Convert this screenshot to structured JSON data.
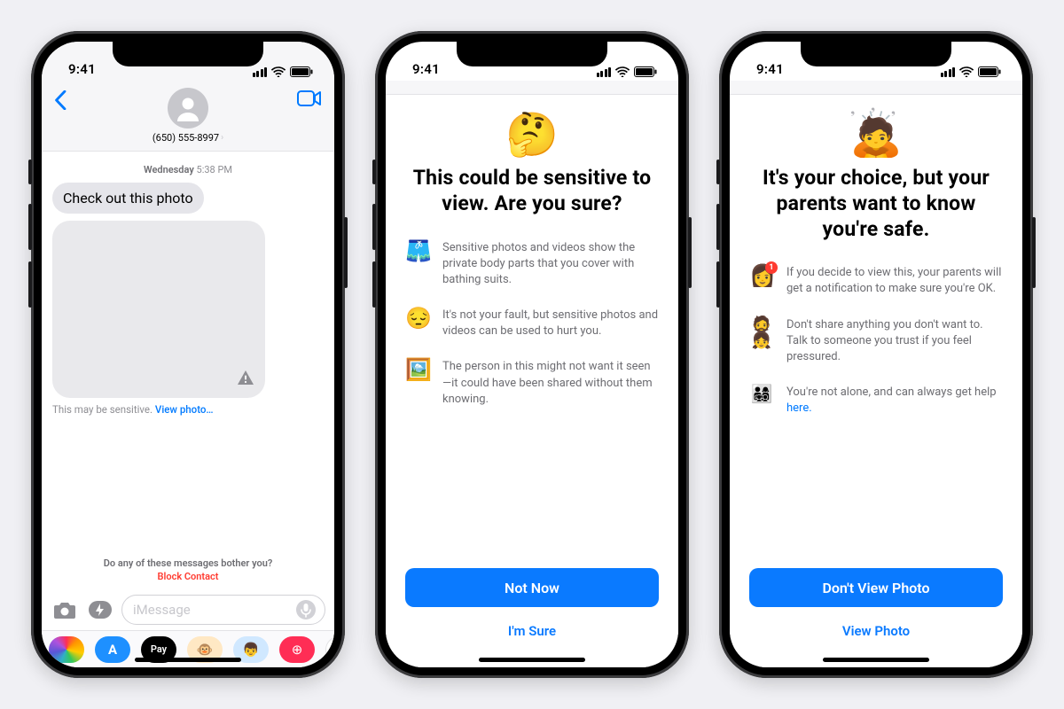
{
  "status": {
    "time": "9:41"
  },
  "messages": {
    "contact_number": "(650) 555-8997",
    "day": "Wednesday",
    "time": "5:38 PM",
    "bubble_text": "Check out this photo",
    "sensitive_label": "This may be sensitive.",
    "view_link": "View photo…",
    "bother_question": "Do any of these messages bother you?",
    "block_contact": "Block Contact",
    "input_placeholder": "iMessage",
    "applepay_label": "Pay"
  },
  "warning1": {
    "emoji": "🤔",
    "title": "This could be sensitive to view. Are you sure?",
    "items": [
      {
        "icon": "🩳",
        "text": "Sensitive photos and videos show the private body parts that you cover with bathing suits."
      },
      {
        "icon": "😔",
        "text": "It's not your fault, but sensitive photos and videos can be used to hurt you."
      },
      {
        "icon": "🖼️",
        "text": "The person in this might not want it seen—it could have been shared without them knowing."
      }
    ],
    "primary": "Not Now",
    "secondary": "I'm Sure"
  },
  "warning2": {
    "emoji": "🙇",
    "title": "It's your choice, but your parents want to know you're safe.",
    "items": [
      {
        "icon": "👩",
        "badge": "1",
        "text": "If you decide to view this, your parents will get a notification to make sure you're OK."
      },
      {
        "icon": "🧔👧",
        "text": "Don't share anything you don't want to. Talk to someone you trust if you feel pressured."
      },
      {
        "icon": "👨‍👩‍👧‍👦",
        "text": "You're not alone, and can always get help ",
        "link": "here."
      }
    ],
    "primary": "Don't View Photo",
    "secondary": "View Photo"
  }
}
